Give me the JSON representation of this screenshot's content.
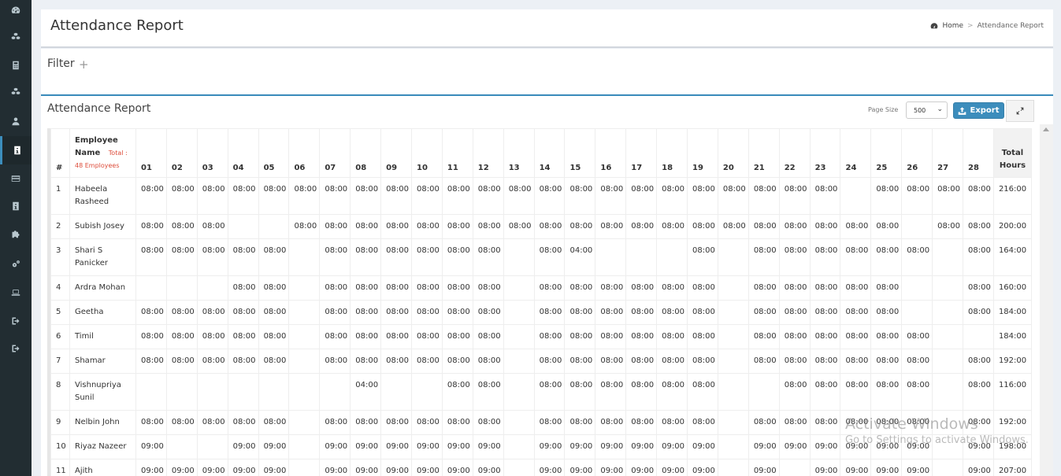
{
  "sidebar": {
    "icons": [
      "dashboard-icon",
      "cubes-icon",
      "calculator-icon",
      "cubes-icon",
      "user-icon",
      "id-card-icon",
      "credit-card-icon",
      "id-badge-icon",
      "puzzle-icon",
      "cogs-icon",
      "laptop-icon",
      "sign-out-icon",
      "sign-out-icon"
    ]
  },
  "header": {
    "title": "Attendance Report",
    "breadcrumb": {
      "home": "Home",
      "separator": ">",
      "current": "Attendance Report"
    }
  },
  "filter": {
    "title": "Filter",
    "plus": "+"
  },
  "report": {
    "title": "Attendance Report",
    "page_size_label": "Page Size",
    "page_size_value": "500",
    "export_label": "Export"
  },
  "table": {
    "headers": {
      "number": "#",
      "employee_name": "Employee Name",
      "total_label": "Total :",
      "total_employees": "48 Employees",
      "days": [
        "01",
        "02",
        "03",
        "04",
        "05",
        "06",
        "07",
        "08",
        "09",
        "10",
        "11",
        "12",
        "13",
        "14",
        "15",
        "16",
        "17",
        "18",
        "19",
        "20",
        "21",
        "22",
        "23",
        "24",
        "25",
        "26",
        "27",
        "28"
      ],
      "total_hours": "Total Hours"
    },
    "rows": [
      {
        "num": "1",
        "name": "Habeela Rasheed",
        "days": [
          "08:00",
          "08:00",
          "08:00",
          "08:00",
          "08:00",
          "08:00",
          "08:00",
          "08:00",
          "08:00",
          "08:00",
          "08:00",
          "08:00",
          "08:00",
          "08:00",
          "08:00",
          "08:00",
          "08:00",
          "08:00",
          "08:00",
          "08:00",
          "08:00",
          "08:00",
          "08:00",
          "",
          "08:00",
          "08:00",
          "08:00",
          "08:00"
        ],
        "total": "216:00"
      },
      {
        "num": "2",
        "name": "Subish Josey",
        "days": [
          "08:00",
          "08:00",
          "08:00",
          "",
          "",
          "08:00",
          "08:00",
          "08:00",
          "08:00",
          "08:00",
          "08:00",
          "08:00",
          "08:00",
          "08:00",
          "08:00",
          "08:00",
          "08:00",
          "08:00",
          "08:00",
          "08:00",
          "08:00",
          "08:00",
          "08:00",
          "08:00",
          "08:00",
          "",
          "08:00",
          "08:00"
        ],
        "total": "200:00"
      },
      {
        "num": "3",
        "name": "Shari S Panicker",
        "days": [
          "08:00",
          "08:00",
          "08:00",
          "08:00",
          "08:00",
          "",
          "08:00",
          "08:00",
          "08:00",
          "08:00",
          "08:00",
          "08:00",
          "",
          "08:00",
          "04:00",
          "",
          "",
          "",
          "08:00",
          "",
          "08:00",
          "08:00",
          "08:00",
          "08:00",
          "08:00",
          "08:00",
          "",
          "08:00"
        ],
        "total": "164:00"
      },
      {
        "num": "4",
        "name": "Ardra Mohan",
        "days": [
          "",
          "",
          "",
          "08:00",
          "08:00",
          "",
          "08:00",
          "08:00",
          "08:00",
          "08:00",
          "08:00",
          "08:00",
          "",
          "08:00",
          "08:00",
          "08:00",
          "08:00",
          "08:00",
          "08:00",
          "",
          "08:00",
          "08:00",
          "08:00",
          "08:00",
          "08:00",
          "",
          "",
          "08:00"
        ],
        "total": "160:00"
      },
      {
        "num": "5",
        "name": "Geetha",
        "days": [
          "08:00",
          "08:00",
          "08:00",
          "08:00",
          "08:00",
          "",
          "08:00",
          "08:00",
          "08:00",
          "08:00",
          "08:00",
          "08:00",
          "",
          "08:00",
          "08:00",
          "08:00",
          "08:00",
          "08:00",
          "08:00",
          "",
          "08:00",
          "08:00",
          "08:00",
          "08:00",
          "08:00",
          "",
          "",
          "08:00"
        ],
        "total": "184:00"
      },
      {
        "num": "6",
        "name": "Timil",
        "days": [
          "08:00",
          "08:00",
          "08:00",
          "08:00",
          "08:00",
          "",
          "08:00",
          "08:00",
          "08:00",
          "08:00",
          "08:00",
          "08:00",
          "",
          "08:00",
          "08:00",
          "08:00",
          "08:00",
          "08:00",
          "08:00",
          "",
          "08:00",
          "08:00",
          "08:00",
          "08:00",
          "08:00",
          "08:00",
          "",
          ""
        ],
        "total": "184:00"
      },
      {
        "num": "7",
        "name": "Shamar",
        "days": [
          "08:00",
          "08:00",
          "08:00",
          "08:00",
          "08:00",
          "",
          "08:00",
          "08:00",
          "08:00",
          "08:00",
          "08:00",
          "08:00",
          "",
          "08:00",
          "08:00",
          "08:00",
          "08:00",
          "08:00",
          "08:00",
          "",
          "08:00",
          "08:00",
          "08:00",
          "08:00",
          "08:00",
          "08:00",
          "",
          "08:00"
        ],
        "total": "192:00"
      },
      {
        "num": "8",
        "name": "Vishnupriya Sunil",
        "days": [
          "",
          "",
          "",
          "",
          "",
          "",
          "",
          "04:00",
          "",
          "",
          "08:00",
          "08:00",
          "",
          "08:00",
          "08:00",
          "08:00",
          "08:00",
          "08:00",
          "08:00",
          "",
          "",
          "08:00",
          "08:00",
          "08:00",
          "08:00",
          "08:00",
          "",
          "08:00"
        ],
        "total": "116:00"
      },
      {
        "num": "9",
        "name": "Nelbin John",
        "days": [
          "08:00",
          "08:00",
          "08:00",
          "08:00",
          "08:00",
          "",
          "08:00",
          "08:00",
          "08:00",
          "08:00",
          "08:00",
          "08:00",
          "",
          "08:00",
          "08:00",
          "08:00",
          "08:00",
          "08:00",
          "08:00",
          "",
          "08:00",
          "08:00",
          "08:00",
          "08:00",
          "08:00",
          "08:00",
          "",
          "08:00"
        ],
        "total": "192:00"
      },
      {
        "num": "10",
        "name": "Riyaz Nazeer",
        "days": [
          "09:00",
          "",
          "",
          "09:00",
          "09:00",
          "",
          "09:00",
          "09:00",
          "09:00",
          "09:00",
          "09:00",
          "09:00",
          "",
          "09:00",
          "09:00",
          "09:00",
          "09:00",
          "09:00",
          "09:00",
          "",
          "09:00",
          "09:00",
          "09:00",
          "09:00",
          "09:00",
          "09:00",
          "",
          "09:00"
        ],
        "total": "198:00"
      },
      {
        "num": "11",
        "name": "Ajith",
        "days": [
          "09:00",
          "09:00",
          "09:00",
          "09:00",
          "09:00",
          "",
          "09:00",
          "09:00",
          "09:00",
          "09:00",
          "09:00",
          "09:00",
          "",
          "09:00",
          "09:00",
          "09:00",
          "09:00",
          "09:00",
          "09:00",
          "",
          "09:00",
          "",
          "09:00",
          "09:00",
          "09:00",
          "09:00",
          "",
          "09:00"
        ],
        "total": "207:00"
      }
    ]
  },
  "watermark": {
    "line1": "Activate Windows",
    "line2": "Go to Settings to activate Windows."
  },
  "colors": {
    "accent": "#3c8dbc",
    "sidebar": "#222d32",
    "danger": "#dd4b39"
  }
}
